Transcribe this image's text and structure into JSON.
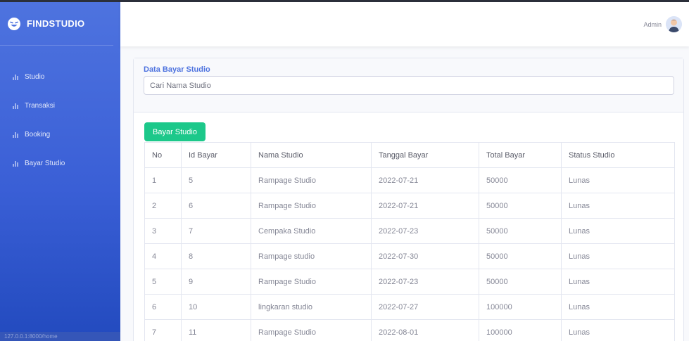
{
  "sidebar": {
    "brand": "FINDSTUDIO",
    "items": [
      {
        "label": "Studio"
      },
      {
        "label": "Transaksi"
      },
      {
        "label": "Booking"
      },
      {
        "label": "Bayar Studio"
      }
    ],
    "status_url": "127.0.0.1:8000/home"
  },
  "topbar": {
    "user_name": "Admin"
  },
  "main": {
    "title": "Data Bayar Studio",
    "search_placeholder": "Cari Nama Studio",
    "pay_button": "Bayar Studio",
    "table": {
      "headers": [
        "No",
        "Id Bayar",
        "Nama Studio",
        "Tanggal Bayar",
        "Total Bayar",
        "Status Studio"
      ],
      "rows": [
        [
          "1",
          "5",
          "Rampage Studio",
          "2022-07-21",
          "50000",
          "Lunas"
        ],
        [
          "2",
          "6",
          "Rampage Studio",
          "2022-07-21",
          "50000",
          "Lunas"
        ],
        [
          "3",
          "7",
          "Cempaka Studio",
          "2022-07-23",
          "50000",
          "Lunas"
        ],
        [
          "4",
          "8",
          "Rampage studio",
          "2022-07-30",
          "50000",
          "Lunas"
        ],
        [
          "5",
          "9",
          "Rampage Studio",
          "2022-07-23",
          "50000",
          "Lunas"
        ],
        [
          "6",
          "10",
          "lingkaran studio",
          "2022-07-27",
          "100000",
          "Lunas"
        ],
        [
          "7",
          "11",
          "Rampage Studio",
          "2022-08-01",
          "100000",
          "Lunas"
        ]
      ]
    }
  },
  "colors": {
    "primary": "#4e73df",
    "success": "#1cc88a",
    "text_muted": "#858796"
  },
  "icons": {
    "brand": "laughing-face-icon",
    "nav": "bar-chart-icon"
  }
}
